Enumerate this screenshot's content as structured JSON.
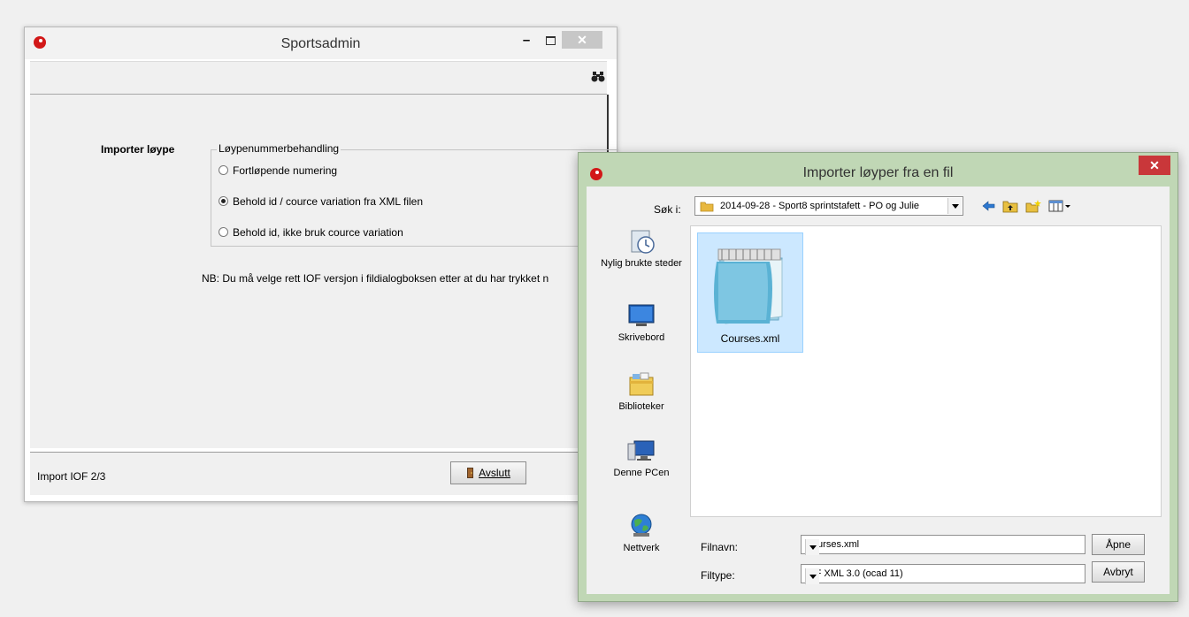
{
  "main_window": {
    "title": "Sportsadmin",
    "minimize_glyph": "–",
    "close_glyph": "✕",
    "import_label": "Importer løype",
    "group_title": "Løypenummerbehandling",
    "options": [
      {
        "label": "Fortløpende numering",
        "selected": false
      },
      {
        "label": "Behold id / cource variation fra XML filen",
        "selected": true
      },
      {
        "label": "Behold id, ikke bruk cource variation",
        "selected": false
      }
    ],
    "note": "NB: Du må velge rett IOF versjon i fildialogboksen  etter at du har trykket n",
    "status": "Import   IOF 2/3",
    "quit_button": "Avslutt"
  },
  "file_dialog": {
    "title": "Importer løyper fra en fil",
    "close_glyph": "✕",
    "look_in_label": "Søk i:",
    "look_in_value": "2014-09-28 - Sport8 sprintstafett - PO og Julie",
    "places": [
      {
        "label": "Nylig brukte steder",
        "icon": "recent-places-icon"
      },
      {
        "label": "Skrivebord",
        "icon": "desktop-icon"
      },
      {
        "label": "Biblioteker",
        "icon": "libraries-icon"
      },
      {
        "label": "Denne PCen",
        "icon": "computer-icon"
      },
      {
        "label": "Nettverk",
        "icon": "network-icon"
      }
    ],
    "files": [
      {
        "name": "Courses.xml",
        "icon": "notepad-icon"
      }
    ],
    "filename_label": "Filnavn:",
    "filename_value": "Courses.xml",
    "filetype_label": "Filtype:",
    "filetype_value": "IOF XML 3.0 (ocad 11)",
    "open_button": "Åpne",
    "cancel_button": "Avbryt"
  },
  "colors": {
    "dialog_frame": "#c0d7b5",
    "close_red": "#c9373a",
    "selection": "#cce8ff",
    "app_icon": "#d21818"
  }
}
